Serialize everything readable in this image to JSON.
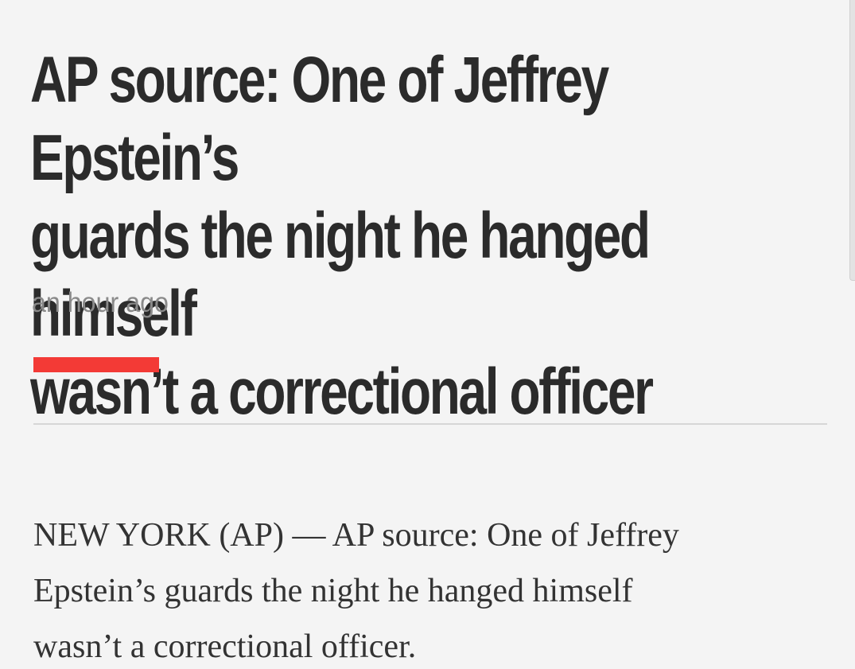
{
  "article": {
    "headline_line1": "AP source: One of Jeffrey Epstein’s",
    "headline_line2": "guards the night he hanged himself",
    "headline_line3": "wasn’t a correctional officer",
    "timestamp": "an hour ago",
    "body_line1": "NEW YORK (AP) — AP source: One of Jeffrey",
    "body_line2": "Epstein’s guards the night he hanged himself",
    "body_line3": "wasn’t a correctional officer."
  },
  "colors": {
    "accent": "#f33a36",
    "headline": "#2b2b2b",
    "meta": "#8a8a8a",
    "background": "#f4f4f4"
  }
}
